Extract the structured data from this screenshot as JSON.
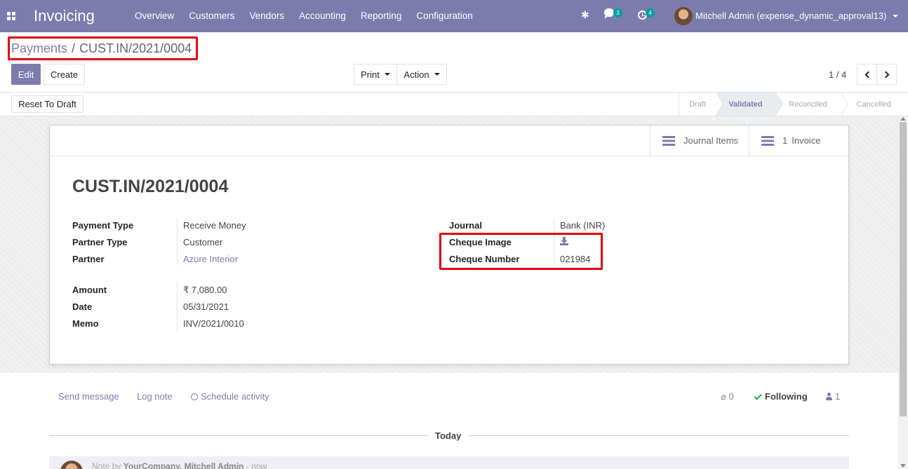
{
  "navbar": {
    "app_name": "Invoicing",
    "menu": [
      "Overview",
      "Customers",
      "Vendors",
      "Accounting",
      "Reporting",
      "Configuration"
    ],
    "messages_badge": "3",
    "activities_badge": "4",
    "user_name": "Mitchell Admin (expense_dynamic_approval13)",
    "accent_color": "#7c7bad"
  },
  "breadcrumb": {
    "parent": "Payments",
    "separator": "/",
    "current": "CUST.IN/2021/0004"
  },
  "toolbar": {
    "edit": "Edit",
    "create": "Create",
    "print": "Print",
    "action": "Action"
  },
  "pager": {
    "value": "1 / 4"
  },
  "statusbar": {
    "reset_button": "Reset To Draft",
    "steps": [
      {
        "label": "Draft",
        "active": false
      },
      {
        "label": "Validated",
        "active": true
      },
      {
        "label": "Reconciled",
        "active": false
      },
      {
        "label": "Cancelled",
        "active": false
      }
    ]
  },
  "smart_buttons": {
    "journal_items": "Journal Items",
    "invoice_count": "1",
    "invoice_label": "Invoice"
  },
  "record": {
    "title": "CUST.IN/2021/0004",
    "left_fields": [
      {
        "label": "Payment Type",
        "value": "Receive Money"
      },
      {
        "label": "Partner Type",
        "value": "Customer"
      },
      {
        "label": "Partner",
        "value": "Azure Interior"
      },
      {
        "label": "Amount",
        "value": "₹ 7,080.00"
      },
      {
        "label": "Date",
        "value": "05/31/2021"
      },
      {
        "label": "Memo",
        "value": "INV/2021/0010"
      }
    ],
    "right_fields": [
      {
        "label": "Journal",
        "value": "Bank (INR)"
      },
      {
        "label": "Cheque Image",
        "value": ""
      },
      {
        "label": "Cheque Number",
        "value": "021984"
      }
    ]
  },
  "chatter": {
    "send_message": "Send message",
    "log_note": "Log note",
    "schedule_activity": "Schedule activity",
    "attachments": "0",
    "following": "Following",
    "followers": "1",
    "today": "Today",
    "note_prefix": "Note by",
    "note_author": "YourCompany, Mitchell Admin",
    "note_time": "- now"
  }
}
